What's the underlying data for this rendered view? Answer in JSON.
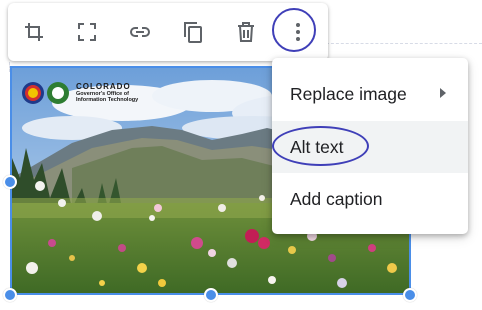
{
  "toolbar": {
    "icons": [
      "crop-icon",
      "fullscreen-icon",
      "link-icon",
      "copy-icon",
      "delete-icon",
      "more-vert-icon"
    ]
  },
  "image": {
    "logo_title": "COLORADO",
    "logo_subtitle_line1": "Governor's Office of",
    "logo_subtitle_line2": "Information Technology",
    "selection_color": "#4a8ee8"
  },
  "menu": {
    "replace_image": "Replace image",
    "alt_text": "Alt text",
    "add_caption": "Add caption"
  },
  "colors": {
    "annotation_ring": "#3f3fb8",
    "menu_highlight": "#f1f3f4",
    "icon": "#5f6368"
  }
}
